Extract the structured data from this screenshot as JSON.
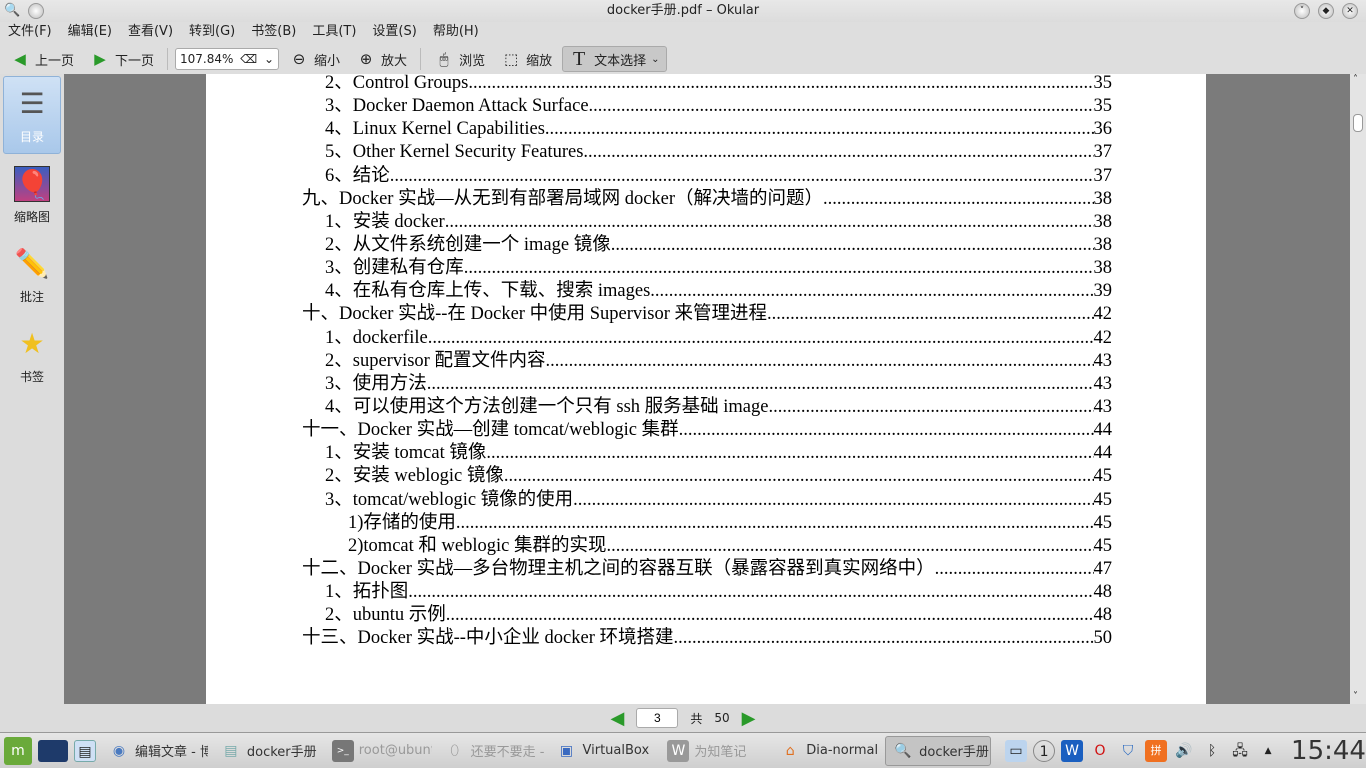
{
  "window": {
    "title": "docker手册.pdf – Okular"
  },
  "menu": [
    "文件(F)",
    "编辑(E)",
    "查看(V)",
    "转到(G)",
    "书签(B)",
    "工具(T)",
    "设置(S)",
    "帮助(H)"
  ],
  "toolbar": {
    "prev": "上一页",
    "next": "下一页",
    "zoom": "107.84%",
    "zoom_out": "缩小",
    "zoom_in": "放大",
    "browse": "浏览",
    "zoom_tool": "缩放",
    "text_select": "文本选择"
  },
  "sidebar": [
    {
      "label": "目录",
      "icon": "toc-icon"
    },
    {
      "label": "缩略图",
      "icon": "thumbnails-icon"
    },
    {
      "label": "批注",
      "icon": "pencil-icon"
    },
    {
      "label": "书签",
      "icon": "star-icon"
    }
  ],
  "toc": [
    {
      "level": 1,
      "text": "2、Control Groups",
      "page": "35"
    },
    {
      "level": 1,
      "text": "3、Docker Daemon Attack Surface",
      "page": "35"
    },
    {
      "level": 1,
      "text": "4、Linux Kernel Capabilities",
      "page": "36"
    },
    {
      "level": 1,
      "text": "5、Other Kernel Security Features",
      "page": "37"
    },
    {
      "level": 1,
      "text": "6、结论",
      "page": "37"
    },
    {
      "level": 0,
      "text": "九、Docker 实战—从无到有部署局域网 docker（解决墙的问题）",
      "page": "38"
    },
    {
      "level": 1,
      "text": "1、安装 docker",
      "page": "38"
    },
    {
      "level": 1,
      "text": "2、从文件系统创建一个 image 镜像",
      "page": "38"
    },
    {
      "level": 1,
      "text": "3、创建私有仓库",
      "page": "38"
    },
    {
      "level": 1,
      "text": "4、在私有仓库上传、下载、搜索 images",
      "page": "39"
    },
    {
      "level": 0,
      "text": "十、Docker 实战--在 Docker 中使用  Supervisor 来管理进程",
      "page": "42"
    },
    {
      "level": 1,
      "text": "1、dockerfile",
      "page": "42"
    },
    {
      "level": 1,
      "text": "2、supervisor 配置文件内容",
      "page": "43"
    },
    {
      "level": 1,
      "text": "3、使用方法",
      "page": "43"
    },
    {
      "level": 1,
      "text": "4、可以使用这个方法创建一个只有 ssh 服务基础 image",
      "page": "43"
    },
    {
      "level": 0,
      "text": "十一、Docker 实战—创建 tomcat/weblogic 集群",
      "page": "44"
    },
    {
      "level": 1,
      "text": "1、安装 tomcat 镜像",
      "page": "44"
    },
    {
      "level": 1,
      "text": "2、安装 weblogic 镜像",
      "page": "45"
    },
    {
      "level": 1,
      "text": "3、tomcat/weblogic 镜像的使用",
      "page": "45"
    },
    {
      "level": 2,
      "text": "1)存储的使用",
      "page": "45"
    },
    {
      "level": 2,
      "text": "2)tomcat 和 weblogic 集群的实现",
      "page": "45"
    },
    {
      "level": 0,
      "text": "十二、Docker 实战—多台物理主机之间的容器互联（暴露容器到真实网络中）",
      "page": "47"
    },
    {
      "level": 1,
      "text": "1、拓扑图",
      "page": "48"
    },
    {
      "level": 1,
      "text": "2、ubuntu 示例",
      "page": "48"
    },
    {
      "level": 0,
      "text": "十三、Docker 实战--中小企业 docker 环境搭建",
      "page": "50"
    }
  ],
  "pagebar": {
    "current": "3",
    "of": "共",
    "total": "50"
  },
  "taskbar": {
    "tasks": [
      {
        "label": "编辑文章 - 博",
        "state": "normal"
      },
      {
        "label": "docker手册 -",
        "state": "normal"
      },
      {
        "label": "root@ubuntu",
        "state": "dim"
      },
      {
        "label": "还要不要走 -",
        "state": "dim"
      },
      {
        "label": "VirtualBox",
        "state": "normal"
      },
      {
        "label": "为知笔记",
        "state": "dim"
      },
      {
        "label": "Dia-normal",
        "state": "normal"
      },
      {
        "label": "docker手册.",
        "state": "active"
      }
    ],
    "clock": "15:44"
  }
}
